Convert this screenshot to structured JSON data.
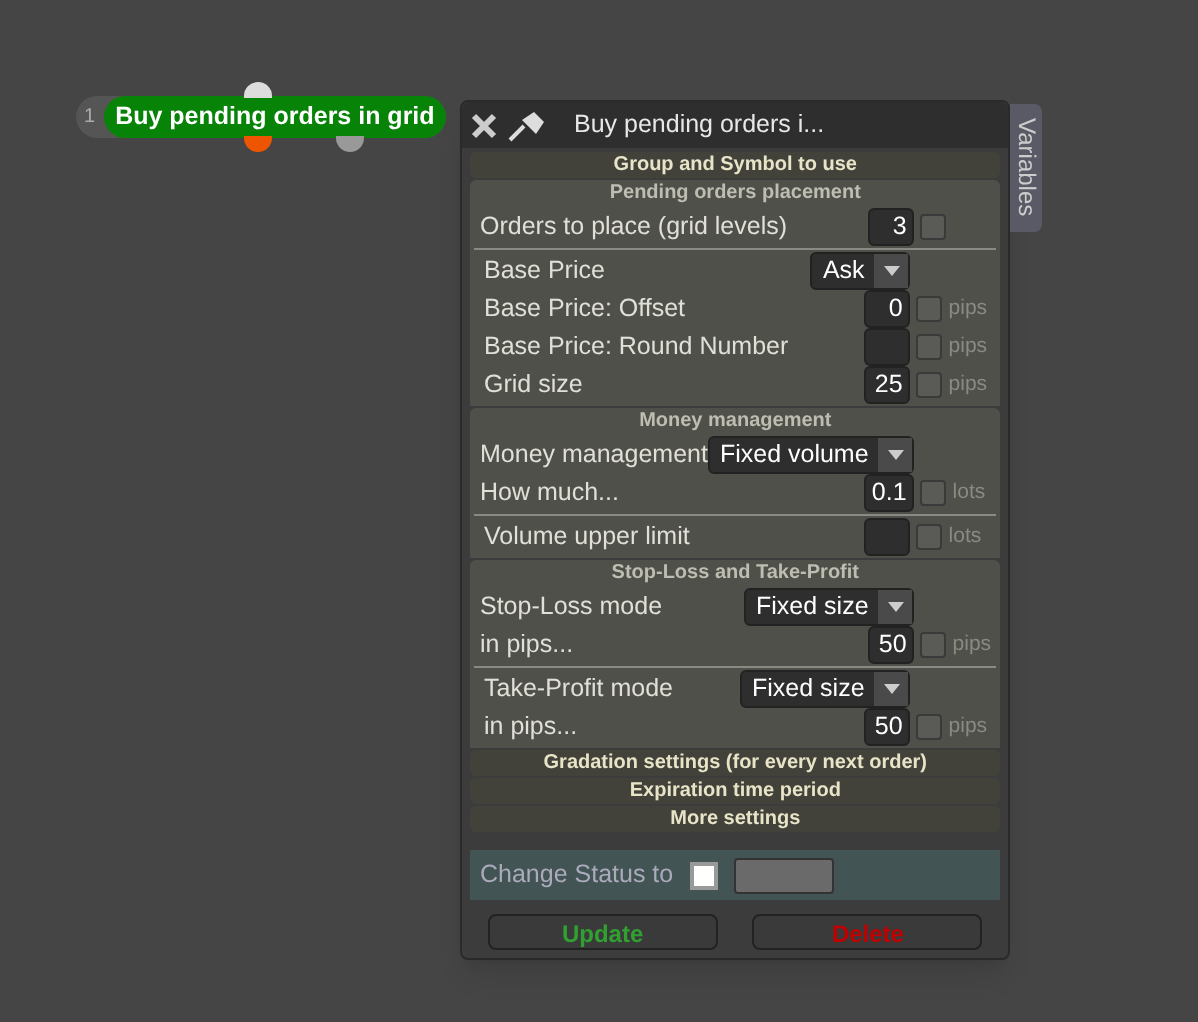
{
  "node": {
    "number": "1",
    "title": "Buy pending orders in grid"
  },
  "panel": {
    "title": "Buy pending orders i...",
    "side_tab": "Variables",
    "sections": [
      {
        "title": "Group and Symbol to use",
        "expanded": false
      },
      {
        "title": "Pending orders placement",
        "expanded": true,
        "groups": [
          [
            {
              "kind": "number",
              "label": "Orders to place (grid levels)",
              "value": "3",
              "checked": false
            }
          ],
          [
            {
              "kind": "select",
              "label": "Base Price",
              "value": "Ask"
            },
            {
              "kind": "number",
              "label": "Base Price: Offset",
              "value": "0",
              "unit": "pips",
              "checked": false
            },
            {
              "kind": "number",
              "label": "Base Price: Round Number",
              "unit": "pips",
              "checked": false
            },
            {
              "kind": "number",
              "label": "Grid size",
              "value": "25",
              "unit": "pips",
              "checked": false
            }
          ]
        ]
      },
      {
        "title": "Money management",
        "expanded": true,
        "groups": [
          [
            {
              "kind": "select",
              "label": "Money management",
              "value": "Fixed volume"
            },
            {
              "kind": "number",
              "label": "How much...",
              "value": "0.1",
              "unit": "lots",
              "checked": false
            }
          ],
          [
            {
              "kind": "number",
              "label": "Volume upper limit",
              "unit": "lots",
              "checked": false
            }
          ]
        ]
      },
      {
        "title": "Stop-Loss and Take-Profit",
        "expanded": true,
        "groups": [
          [
            {
              "kind": "select",
              "label": "Stop-Loss mode",
              "value": "Fixed size"
            },
            {
              "kind": "number",
              "label": "in pips...",
              "value": "50",
              "unit": "pips",
              "checked": false
            }
          ],
          [
            {
              "kind": "select",
              "label": "Take-Profit mode",
              "value": "Fixed size"
            },
            {
              "kind": "number",
              "label": "in pips...",
              "value": "50",
              "unit": "pips",
              "checked": false
            }
          ]
        ]
      },
      {
        "title": "Gradation settings (for every next order)",
        "expanded": false
      },
      {
        "title": "Expiration time period",
        "expanded": false
      },
      {
        "title": "More settings",
        "expanded": false
      }
    ],
    "status": {
      "label": "Change Status to",
      "checked": false
    },
    "buttons": [
      {
        "label": "Update",
        "kind": "update"
      },
      {
        "label": "Delete",
        "kind": "delete"
      }
    ]
  }
}
